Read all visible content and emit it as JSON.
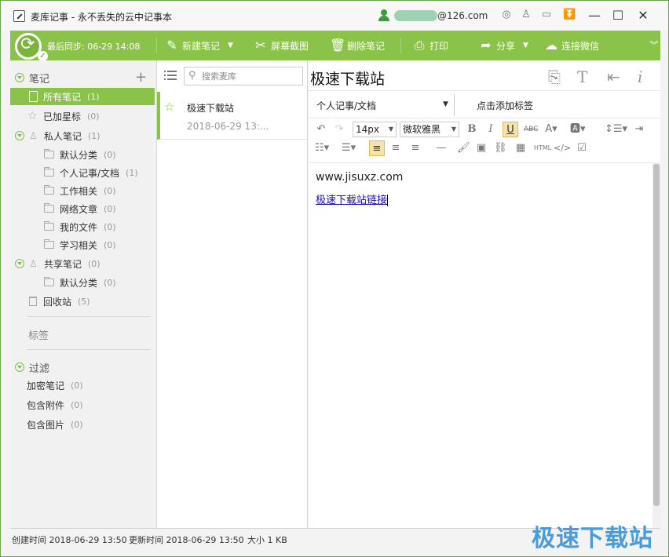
{
  "window": {
    "title": "麦库记事 - 永不丢失的云中记事本",
    "account": "@126.com",
    "icons": [
      "skin-icon",
      "shirt-icon",
      "message-icon",
      "download-icon"
    ],
    "controls": [
      "minimize",
      "maximize",
      "close"
    ]
  },
  "toolbar": {
    "sync_label": "最后同步: 06-29 14:08",
    "new_note": "新建笔记",
    "screenshot": "屏幕截图",
    "delete_note": "删除笔记",
    "print": "打印",
    "share": "分享",
    "wechat": "连接微信"
  },
  "sidebar": {
    "notes_section": "笔记",
    "all_notes": {
      "label": "所有笔记",
      "count": "(1)"
    },
    "starred": {
      "label": "已加星标",
      "count": "(0)"
    },
    "private": {
      "label": "私人笔记",
      "count": "(1)"
    },
    "private_folders": [
      {
        "label": "默认分类",
        "count": "(0)"
      },
      {
        "label": "个人记事/文档",
        "count": "(1)"
      },
      {
        "label": "工作相关",
        "count": "(0)"
      },
      {
        "label": "网络文章",
        "count": "(0)"
      },
      {
        "label": "我的文件",
        "count": "(0)"
      },
      {
        "label": "学习相关",
        "count": "(0)"
      }
    ],
    "shared": {
      "label": "共享笔记",
      "count": "(0)"
    },
    "shared_folders": [
      {
        "label": "默认分类",
        "count": "(0)"
      }
    ],
    "trash": {
      "label": "回收站",
      "count": "(5)"
    },
    "tags_section": "标签",
    "filter_section": "过滤",
    "filters": [
      {
        "label": "加密笔记",
        "count": "(0)"
      },
      {
        "label": "包含附件",
        "count": "(0)"
      },
      {
        "label": "包含图片",
        "count": "(0)"
      }
    ]
  },
  "notelist": {
    "search_placeholder": "搜索麦库",
    "notes": [
      {
        "title": "极速下载站",
        "date": "2018-06-29 13:..."
      }
    ]
  },
  "editor": {
    "title": "极速下载站",
    "folder": "个人记事/文档",
    "tag_placeholder": "点击添加标签",
    "font_size": "14px",
    "font_family": "微软雅黑",
    "html_label": "HTML",
    "content_text": "www.jisuxz.com",
    "content_link": "极速下载站链接"
  },
  "status": {
    "created": "创建时间 2018-06-29 13:50",
    "updated": "更新时间 2018-06-29 13:50",
    "size": "大小 1 KB"
  },
  "watermark": "极速下载站",
  "colors": {
    "accent": "#8bc34a",
    "link": "#1a0dab",
    "watermark": "#4a9bd8"
  }
}
